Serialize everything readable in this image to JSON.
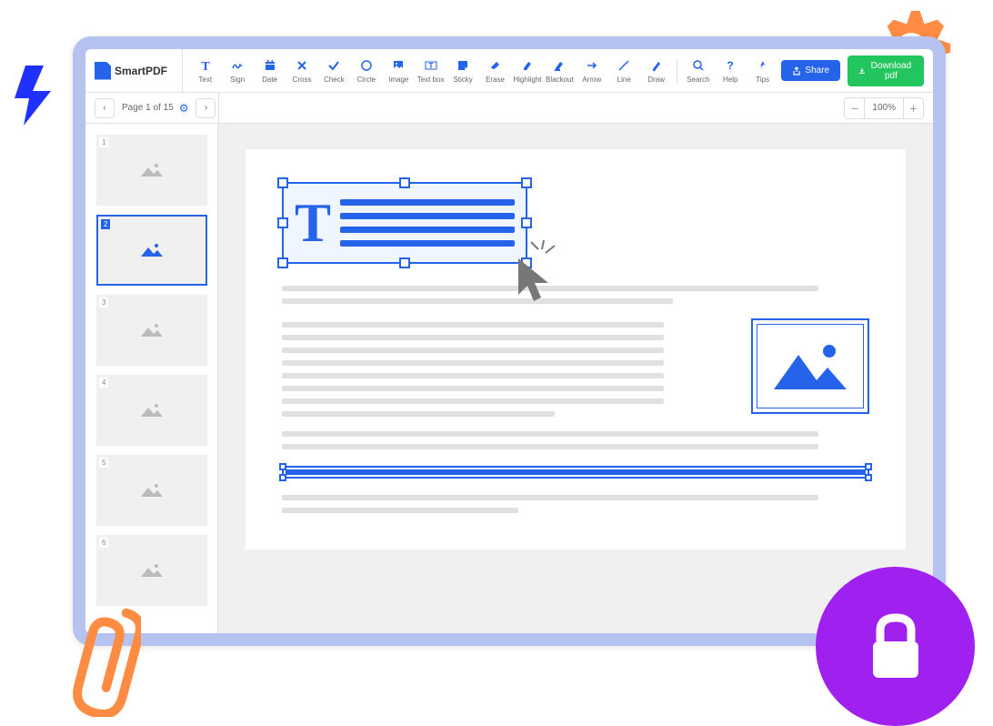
{
  "app": {
    "name": "SmartPDF"
  },
  "toolbar": {
    "tools": [
      {
        "id": "text",
        "label": "Text"
      },
      {
        "id": "sign",
        "label": "Sign"
      },
      {
        "id": "date",
        "label": "Date"
      },
      {
        "id": "cross",
        "label": "Cross"
      },
      {
        "id": "check",
        "label": "Check"
      },
      {
        "id": "circle",
        "label": "Circle"
      },
      {
        "id": "image",
        "label": "Image"
      },
      {
        "id": "textbox",
        "label": "Text box"
      },
      {
        "id": "sticky",
        "label": "Sticky"
      },
      {
        "id": "erase",
        "label": "Erase"
      },
      {
        "id": "highlight",
        "label": "Highlight"
      },
      {
        "id": "blackout",
        "label": "Blackout"
      },
      {
        "id": "arrow",
        "label": "Arrow"
      },
      {
        "id": "line",
        "label": "Line"
      },
      {
        "id": "draw",
        "label": "Draw"
      }
    ],
    "utilities": [
      {
        "id": "search",
        "label": "Search"
      },
      {
        "id": "help",
        "label": "Help"
      },
      {
        "id": "tips",
        "label": "Tips"
      }
    ],
    "share": "Share",
    "download": "Download pdf"
  },
  "pager": {
    "text": "Page 1 of 15",
    "zoom": "100%"
  },
  "thumbs": {
    "count": 6,
    "active": 2,
    "labels": [
      "1",
      "2",
      "3",
      "4",
      "5",
      "6"
    ]
  },
  "textblock": {
    "glyph": "T"
  }
}
